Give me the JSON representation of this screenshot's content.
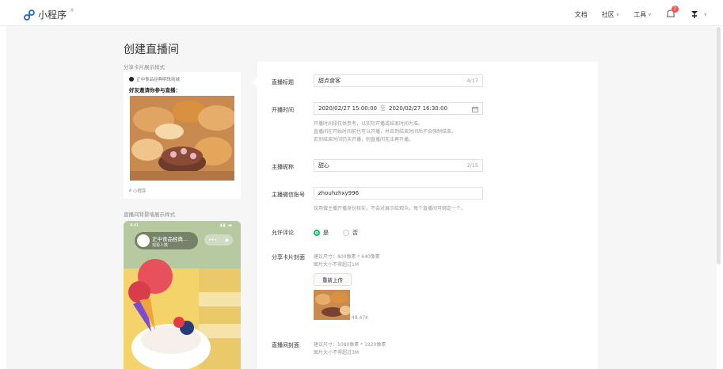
{
  "app": {
    "name": "小程序"
  },
  "topnav": {
    "docs": "文档",
    "community": "社区",
    "tools": "工具",
    "notifications_badge": "7"
  },
  "page": {
    "title": "创建直播间"
  },
  "preview": {
    "share_card_label": "分享卡片展示样式",
    "share_card": {
      "store_name": "正中食品经典明珠商城",
      "invite_text": "好友邀请你参与直播：",
      "footer": "小程序"
    },
    "background_label": "直播间背景墙展示样式",
    "phone": {
      "time": "9:41",
      "room_name": "正中食品经典...",
      "viewers": "观看人数"
    }
  },
  "form": {
    "title": {
      "label": "直播标题",
      "value": "甜点食客",
      "count": "4/17"
    },
    "time": {
      "label": "开播时间",
      "start": "2020/02/27 15:00:00",
      "sep": "至",
      "end": "2020/02/27 16:30:00",
      "hint1": "开播时间段仅供参考，以实际开播或结束时间为准。",
      "hint2": "直播间在开始时间前也可以开播，并且到结束时间后不会强制结束。",
      "hint3": "若到结束时间仍未开播，则直播间无法再开播。"
    },
    "nickname": {
      "label": "主播昵称",
      "value": "甜心",
      "count": "2/15"
    },
    "wechat": {
      "label": "主播微信账号",
      "value": "zhouhzhxy996",
      "hint": "仅用做主播开播身份核实，不会对展示给观众。每个直播间可绑定一个。"
    },
    "comments": {
      "label": "允许评论",
      "yes": "是",
      "no": "否"
    },
    "share_cover": {
      "label": "分享卡片封面",
      "hint1": "建议尺寸：800像素 * 640像素",
      "hint2": "图片大小不得超过1M",
      "button": "重新上传",
      "size": "48.47K"
    },
    "bg_cover": {
      "label": "直播间封面",
      "hint1": "建议尺寸：1080像素 * 1920像素",
      "hint2": "图片大小不得超过3M"
    }
  },
  "colors": {
    "accent": "#07c160",
    "badge": "#fa5151",
    "brand": "#1f69d6"
  }
}
